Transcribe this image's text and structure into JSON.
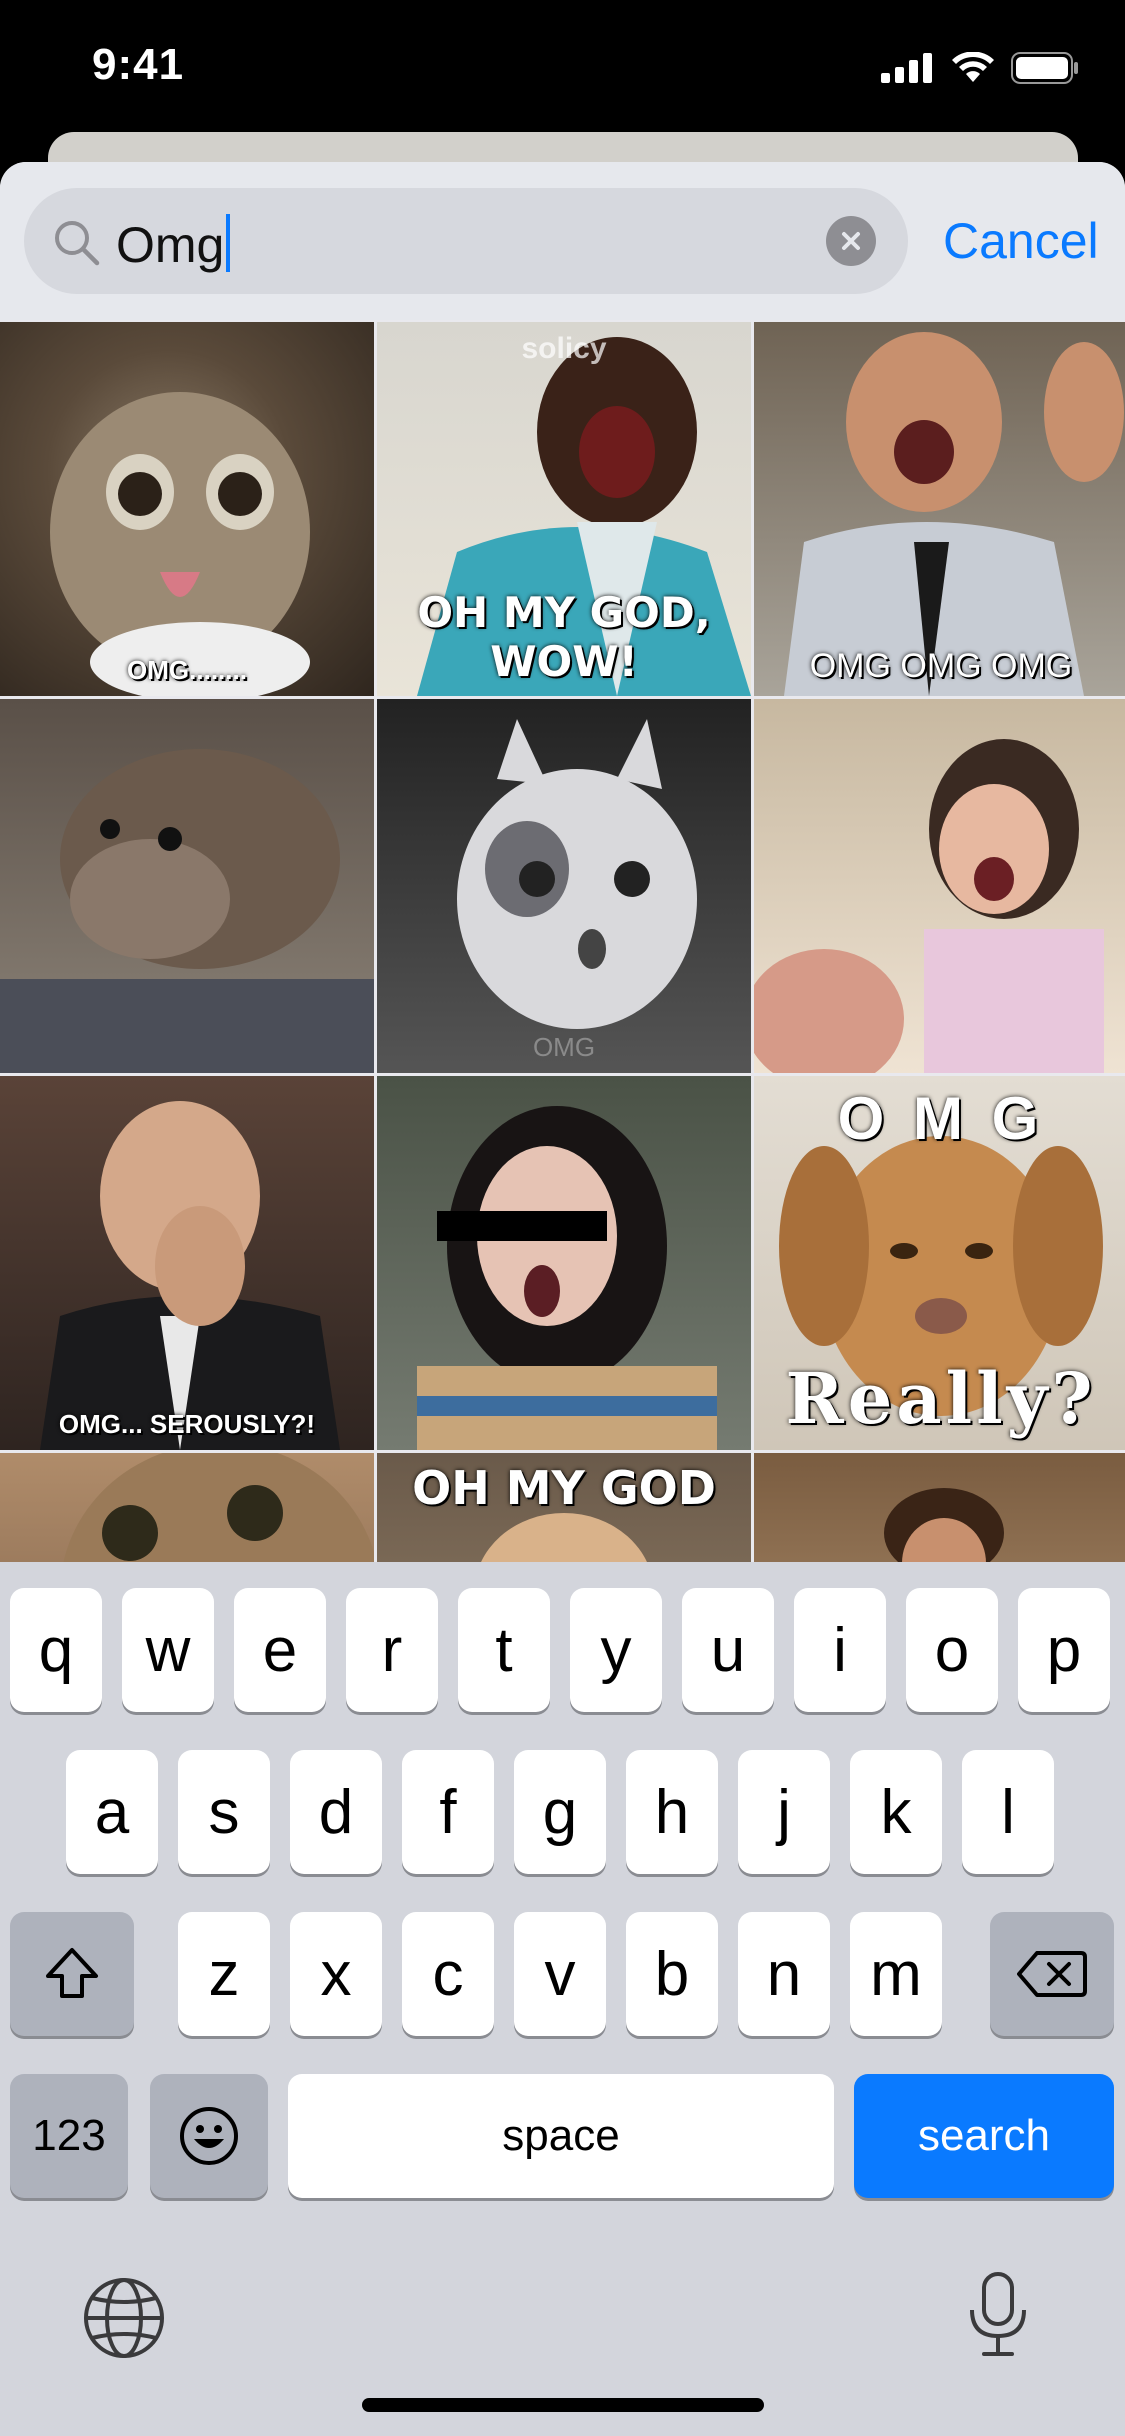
{
  "status_bar": {
    "time": "9:41",
    "icons": [
      "cellular-signal-icon",
      "wifi-icon",
      "battery-icon"
    ]
  },
  "search": {
    "value": "Omg",
    "cancel_label": "Cancel",
    "icons": [
      "search-icon",
      "clear-icon"
    ]
  },
  "results": [
    {
      "caption": "OMG........",
      "watermark": "",
      "subject": "cat with tongue out"
    },
    {
      "caption": "OH MY GOD, WOW!",
      "watermark": "solicy",
      "subject": "man laughing"
    },
    {
      "caption": "OMG OMG OMG",
      "watermark": "",
      "subject": "man cheering"
    },
    {
      "caption": "",
      "watermark": "",
      "subject": "otter"
    },
    {
      "caption": "OMG",
      "watermark": "",
      "subject": "shocked cat"
    },
    {
      "caption": "",
      "watermark": "",
      "subject": "girl screaming"
    },
    {
      "caption": "OMG... SEROUSLY?!",
      "watermark": "",
      "subject": "man facepalm"
    },
    {
      "caption": "",
      "watermark": "",
      "subject": "woman with pixel sunglasses"
    },
    {
      "caption_top": "O M G",
      "caption": "Really?",
      "watermark": "",
      "subject": "puppy"
    },
    {
      "caption": "",
      "watermark": "",
      "subject": "tabby cat"
    },
    {
      "caption_top": "OH MY GOD",
      "caption": "",
      "watermark": "",
      "subject": "person"
    },
    {
      "caption": "",
      "watermark": "",
      "subject": "person in doorway"
    }
  ],
  "keyboard": {
    "row1": [
      "q",
      "w",
      "e",
      "r",
      "t",
      "y",
      "u",
      "i",
      "o",
      "p"
    ],
    "row2": [
      "a",
      "s",
      "d",
      "f",
      "g",
      "h",
      "j",
      "k",
      "l"
    ],
    "row3": [
      "z",
      "x",
      "c",
      "v",
      "b",
      "n",
      "m"
    ],
    "numbers_label": "123",
    "space_label": "space",
    "search_label": "search",
    "icons": [
      "shift-icon",
      "backspace-icon",
      "emoji-icon",
      "globe-icon",
      "microphone-icon"
    ]
  },
  "colors": {
    "accent": "#0a7aff",
    "sheet_bg": "#e9e9ee",
    "keyboard_bg": "#d3d5dc"
  }
}
